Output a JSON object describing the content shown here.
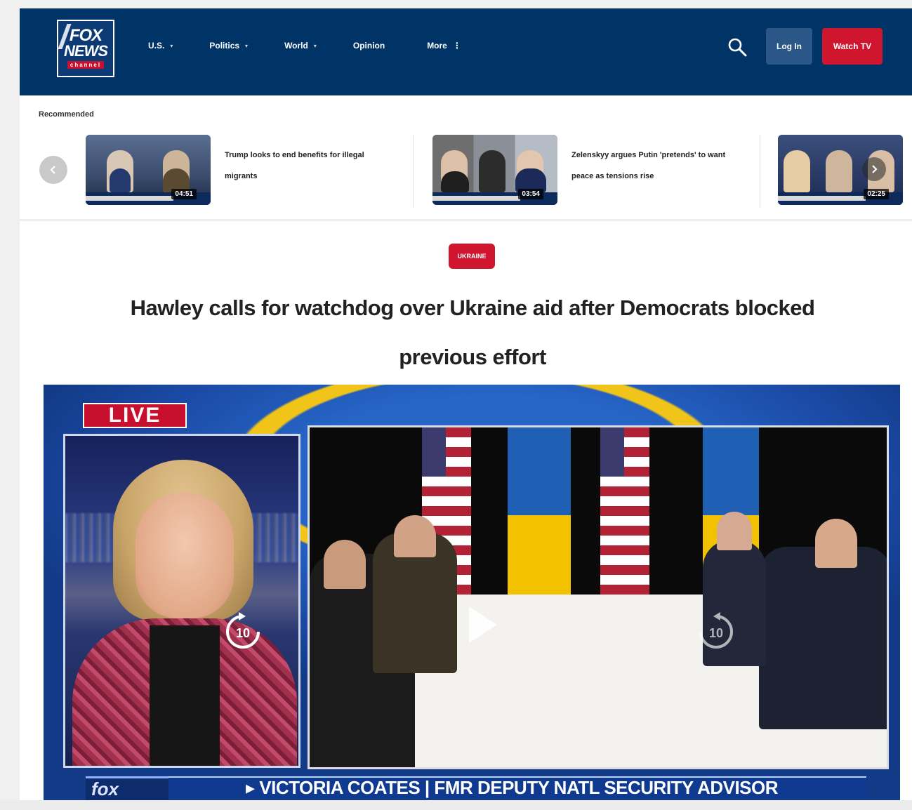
{
  "header": {
    "logo": {
      "line1": "FOX",
      "line2": "NEWS",
      "line3": "channel"
    },
    "nav": [
      {
        "label": "U.S.",
        "chevron": "▾"
      },
      {
        "label": "Politics",
        "chevron": "▾"
      },
      {
        "label": "World",
        "chevron": "▾"
      },
      {
        "label": "Opinion",
        "chevron": ""
      },
      {
        "label": "More",
        "chevron": "⋮"
      }
    ],
    "search_icon": "search-icon",
    "login_label": "Log In",
    "watch_label": "Watch TV",
    "colors": {
      "bg": "#003366",
      "watch": "#d0152f",
      "login": "#2a5688"
    }
  },
  "recommended": {
    "label": "Recommended",
    "items": [
      {
        "title": "Trump looks to end benefits for illegal migrants",
        "duration": "04:51"
      },
      {
        "title": "Zelenskyy argues Putin 'pretends' to want peace as tensions rise",
        "duration": "03:54"
      },
      {
        "title": "",
        "duration": "02:25"
      }
    ]
  },
  "article": {
    "tag": "UKRAINE",
    "headline": "Hawley calls for watchdog over Ukraine aid after Democrats blocked previous effort"
  },
  "video": {
    "live_label": "LIVE",
    "lower_third": "▸ VICTORIA COATES | FMR DEPUTY NATL SECURITY ADVISOR",
    "rewind_label": "10",
    "forward_label": "10",
    "bug": "fox"
  }
}
